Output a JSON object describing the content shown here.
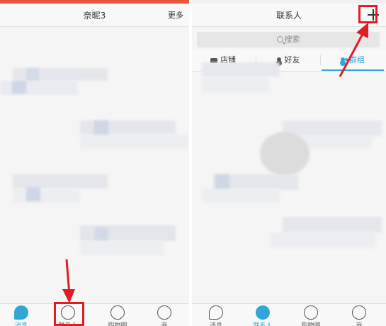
{
  "accent_color": "#32a6d6",
  "annotation_color": "#e01d25",
  "left_screen": {
    "title": "奈昵3",
    "more_label": "更多",
    "nav": [
      {
        "label": "消息",
        "icon": "chat-bubble-icon",
        "active": true
      },
      {
        "label": "联系人",
        "icon": "contacts-icon",
        "active": false
      },
      {
        "label": "购物圈",
        "icon": "shopping-circle-icon",
        "active": false
      },
      {
        "label": "我",
        "icon": "me-icon",
        "active": false
      }
    ]
  },
  "right_screen": {
    "title": "联系人",
    "add_icon": "plus-icon",
    "search_placeholder": "搜索",
    "tabs": [
      {
        "label": "店铺",
        "icon": "shop-icon",
        "active": false
      },
      {
        "label": "好友",
        "icon": "friend-icon",
        "active": false
      },
      {
        "label": "群组",
        "icon": "group-icon",
        "active": true
      }
    ],
    "nav": [
      {
        "label": "消息",
        "icon": "chat-bubble-icon",
        "active": false
      },
      {
        "label": "联系人",
        "icon": "contacts-icon",
        "active": true
      },
      {
        "label": "购物圈",
        "icon": "shopping-circle-icon",
        "active": false
      },
      {
        "label": "我",
        "icon": "me-icon",
        "active": false
      }
    ]
  }
}
